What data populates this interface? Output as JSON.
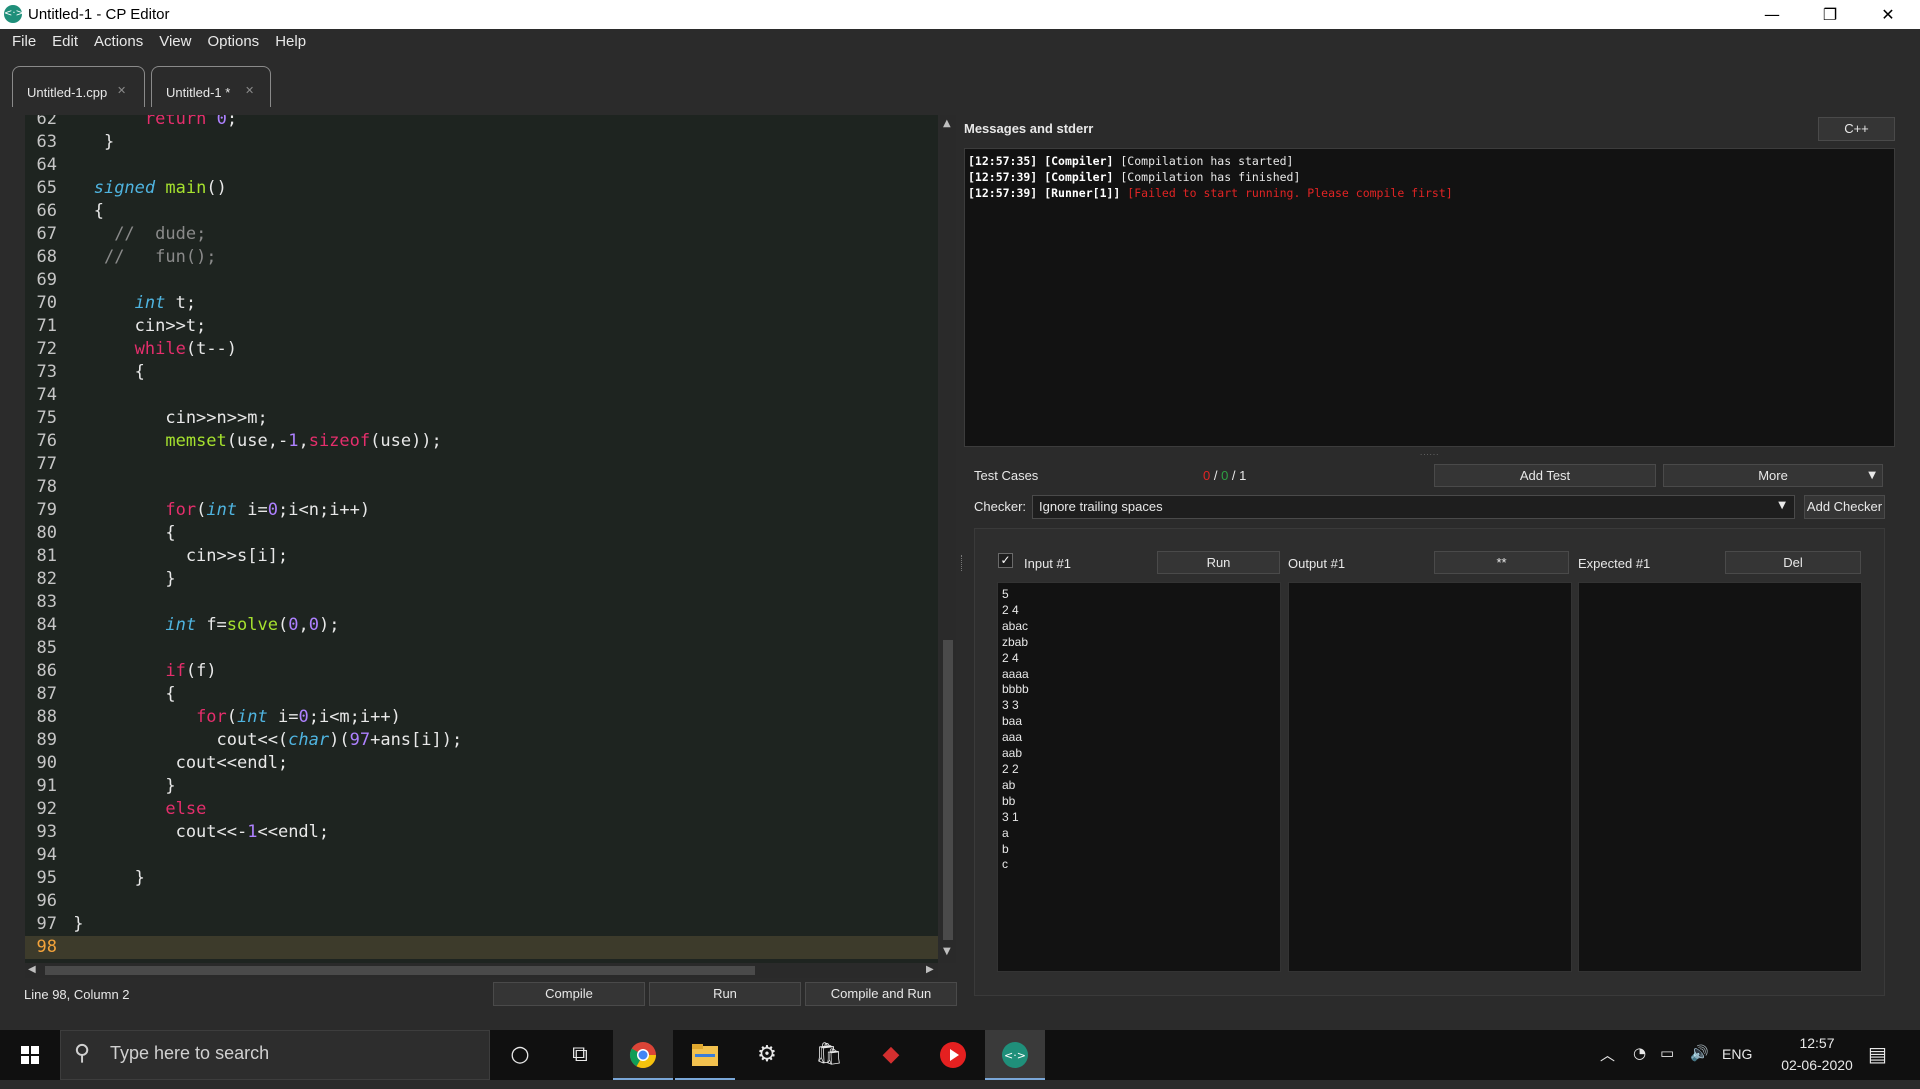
{
  "window": {
    "title": "Untitled-1 - CP Editor",
    "app_icon": "<·>",
    "minimize": "—",
    "maximize": "❐",
    "close": "✕"
  },
  "menu": [
    "File",
    "Edit",
    "Actions",
    "View",
    "Options",
    "Help"
  ],
  "tabs": [
    {
      "label": "Untitled-1.cpp",
      "close": "✕"
    },
    {
      "label": "Untitled-1 *",
      "close": "✕"
    }
  ],
  "editor": {
    "lines": [
      {
        "n": "62",
        "parts": [
          [
            "        ",
            ""
          ],
          [
            "return",
            "kw"
          ],
          [
            " ",
            ""
          ],
          [
            "0",
            "num"
          ],
          [
            ";",
            ""
          ]
        ]
      },
      {
        "n": "63",
        "parts": [
          [
            "    }",
            ""
          ]
        ]
      },
      {
        "n": "64",
        "parts": []
      },
      {
        "n": "65",
        "parts": [
          [
            "   ",
            ""
          ],
          [
            "signed",
            "ty"
          ],
          [
            " ",
            ""
          ],
          [
            "main",
            "fn"
          ],
          [
            "()",
            ""
          ]
        ]
      },
      {
        "n": "66",
        "parts": [
          [
            "   {",
            ""
          ]
        ]
      },
      {
        "n": "67",
        "parts": [
          [
            "     ",
            ""
          ],
          [
            "//  dude;",
            "cm"
          ]
        ]
      },
      {
        "n": "68",
        "parts": [
          [
            "    ",
            ""
          ],
          [
            "//   fun();",
            "cm"
          ]
        ]
      },
      {
        "n": "69",
        "parts": []
      },
      {
        "n": "70",
        "parts": [
          [
            "       ",
            ""
          ],
          [
            "int",
            "ty"
          ],
          [
            " t;",
            ""
          ]
        ]
      },
      {
        "n": "71",
        "parts": [
          [
            "       cin>>t;",
            ""
          ]
        ]
      },
      {
        "n": "72",
        "parts": [
          [
            "       ",
            ""
          ],
          [
            "while",
            "kw"
          ],
          [
            "(t--)",
            ""
          ]
        ]
      },
      {
        "n": "73",
        "parts": [
          [
            "       {",
            ""
          ]
        ]
      },
      {
        "n": "74",
        "parts": []
      },
      {
        "n": "75",
        "parts": [
          [
            "          cin>>n>>m;",
            ""
          ]
        ]
      },
      {
        "n": "76",
        "parts": [
          [
            "          ",
            ""
          ],
          [
            "memset",
            "fn"
          ],
          [
            "(use,-",
            ""
          ],
          [
            "1",
            "num"
          ],
          [
            ",",
            ""
          ],
          [
            "sizeof",
            "kw"
          ],
          [
            "(use));",
            ""
          ]
        ]
      },
      {
        "n": "77",
        "parts": []
      },
      {
        "n": "78",
        "parts": []
      },
      {
        "n": "79",
        "parts": [
          [
            "          ",
            ""
          ],
          [
            "for",
            "kw"
          ],
          [
            "(",
            ""
          ],
          [
            "int",
            "ty"
          ],
          [
            " i=",
            ""
          ],
          [
            "0",
            "num"
          ],
          [
            ";i<n;i++)",
            ""
          ]
        ]
      },
      {
        "n": "80",
        "parts": [
          [
            "          {",
            ""
          ]
        ]
      },
      {
        "n": "81",
        "parts": [
          [
            "            cin>>s[i];",
            ""
          ]
        ]
      },
      {
        "n": "82",
        "parts": [
          [
            "          }",
            ""
          ]
        ]
      },
      {
        "n": "83",
        "parts": []
      },
      {
        "n": "84",
        "parts": [
          [
            "          ",
            ""
          ],
          [
            "int",
            "ty"
          ],
          [
            " f=",
            ""
          ],
          [
            "solve",
            "fn"
          ],
          [
            "(",
            ""
          ],
          [
            "0",
            "num"
          ],
          [
            ",",
            ""
          ],
          [
            "0",
            "num"
          ],
          [
            ");",
            ""
          ]
        ]
      },
      {
        "n": "85",
        "parts": []
      },
      {
        "n": "86",
        "parts": [
          [
            "          ",
            ""
          ],
          [
            "if",
            "kw"
          ],
          [
            "(f)",
            ""
          ]
        ]
      },
      {
        "n": "87",
        "parts": [
          [
            "          {",
            ""
          ]
        ]
      },
      {
        "n": "88",
        "parts": [
          [
            "             ",
            ""
          ],
          [
            "for",
            "kw"
          ],
          [
            "(",
            ""
          ],
          [
            "int",
            "ty"
          ],
          [
            " i=",
            ""
          ],
          [
            "0",
            "num"
          ],
          [
            ";i<m;i++)",
            ""
          ]
        ]
      },
      {
        "n": "89",
        "parts": [
          [
            "               cout<<(",
            ""
          ],
          [
            "char",
            "ty"
          ],
          [
            ")(",
            ""
          ],
          [
            "97",
            "num"
          ],
          [
            "+ans[i]);",
            ""
          ]
        ]
      },
      {
        "n": "90",
        "parts": [
          [
            "           cout<<endl;",
            ""
          ]
        ]
      },
      {
        "n": "91",
        "parts": [
          [
            "          }",
            ""
          ]
        ]
      },
      {
        "n": "92",
        "parts": [
          [
            "          ",
            ""
          ],
          [
            "else",
            "kw"
          ]
        ]
      },
      {
        "n": "93",
        "parts": [
          [
            "           cout<<-",
            ""
          ],
          [
            "1",
            "num"
          ],
          [
            "<<endl;",
            ""
          ]
        ]
      },
      {
        "n": "94",
        "parts": []
      },
      {
        "n": "95",
        "parts": [
          [
            "       }",
            ""
          ]
        ]
      },
      {
        "n": "96",
        "parts": []
      },
      {
        "n": "97",
        "parts": [
          [
            " }",
            ""
          ]
        ]
      },
      {
        "n": "98",
        "parts": [],
        "current": true
      }
    ]
  },
  "statusbar": {
    "position": "Line 98, Column 2"
  },
  "bottom_buttons": {
    "compile": "Compile",
    "run": "Run",
    "compile_and_run": "Compile and Run"
  },
  "messages": {
    "title": "Messages and stderr",
    "language": "C++",
    "log": [
      {
        "time": "[12:57:35]",
        "source": "[Compiler]",
        "text": "[Compilation has started]",
        "error": false
      },
      {
        "time": "[12:57:39]",
        "source": "[Compiler]",
        "text": "[Compilation has finished]",
        "error": false
      },
      {
        "time": "[12:57:39]",
        "source": "[Runner[1]]",
        "text": "[Failed to start running. Please compile first]",
        "error": true
      }
    ]
  },
  "test_cases": {
    "label": "Test Cases",
    "count_failed": "0",
    "count_passed": "0",
    "count_total": "1",
    "add_test": "Add Test",
    "more": "More",
    "checker_label": "Checker:",
    "checker_value": "Ignore trailing spaces",
    "add_checker": "Add Checker",
    "input_label": "Input #1",
    "run": "Run",
    "output_label": "Output #1",
    "diff": "**",
    "expected_label": "Expected #1",
    "del": "Del",
    "input_text": "5\n2 4\nabac\nzbab\n2 4\naaaa\nbbbb\n3 3\nbaa\naaa\naab\n2 2\nab\nbb\n3 1\na\nb\nc",
    "output_text": "",
    "expected_text": ""
  },
  "taskbar": {
    "search_placeholder": "Type here to search",
    "time": "12:57",
    "date": "02-06-2020",
    "language": "ENG"
  },
  "colors": {
    "accent_red": "#e02424",
    "accent_green": "#2ea043",
    "editor_bg": "#1e2420"
  }
}
